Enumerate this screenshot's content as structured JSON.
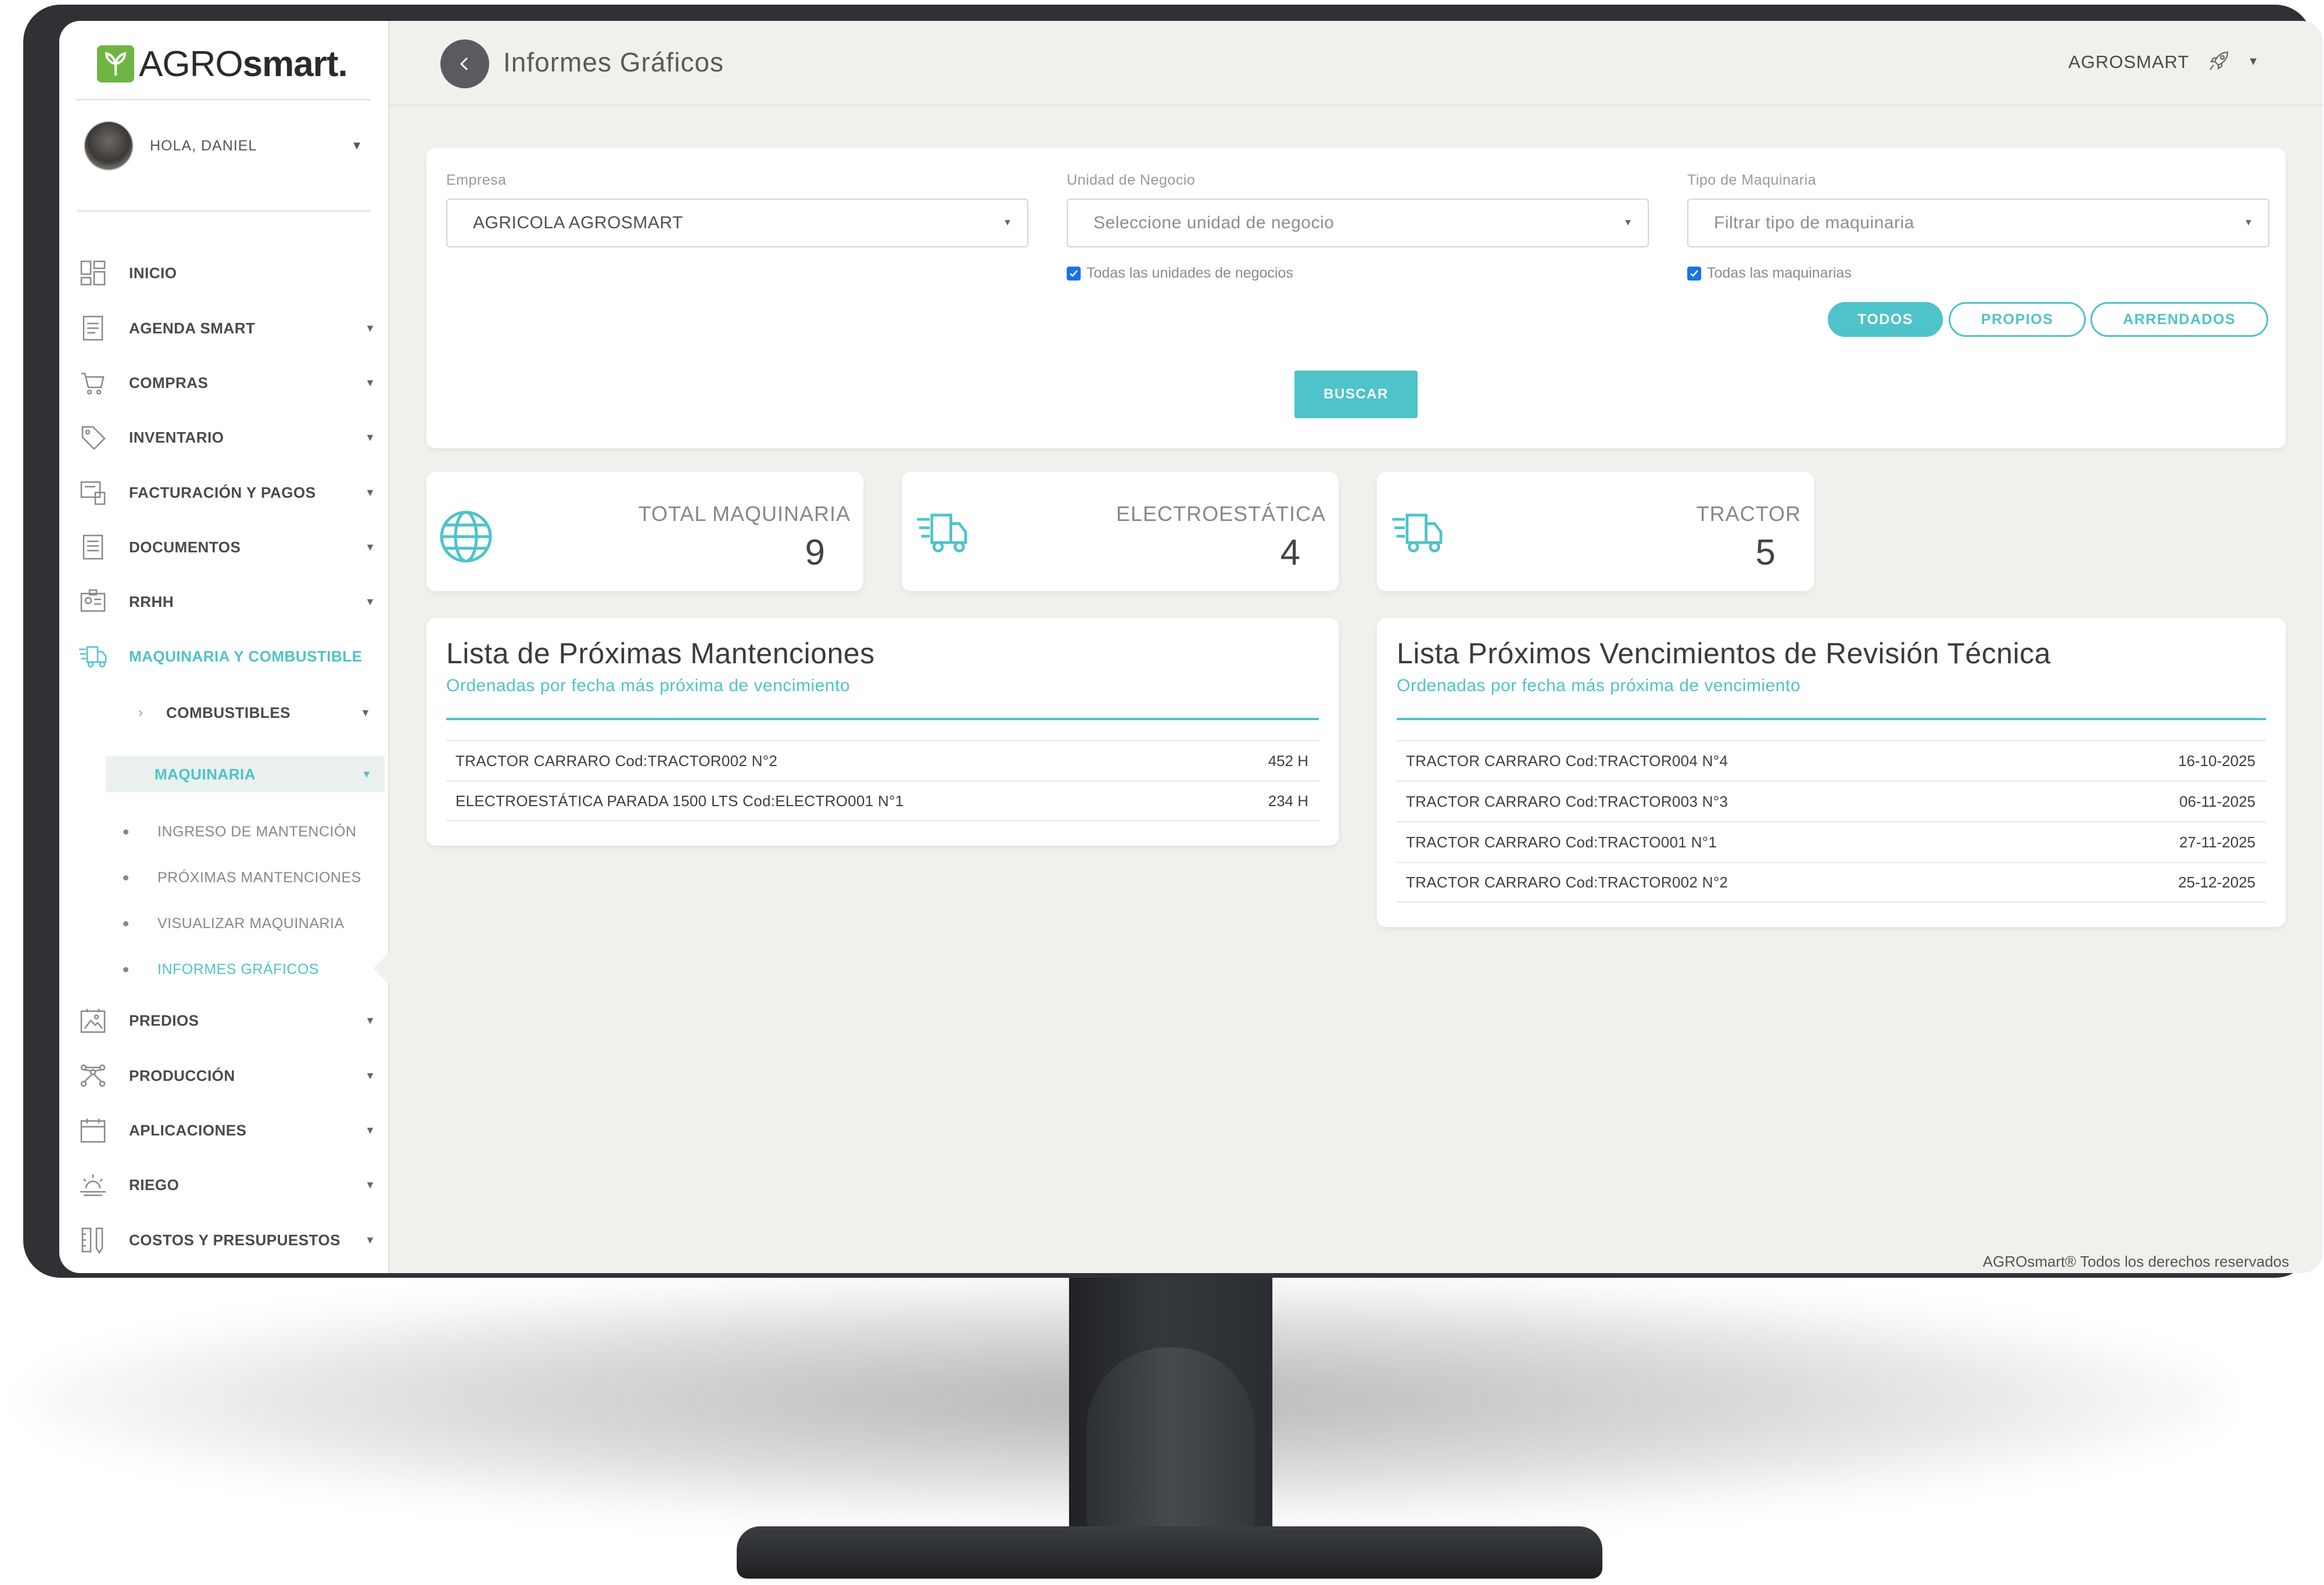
{
  "app": {
    "logo_prefix": "AGRO",
    "logo_suffix": "smart."
  },
  "user": {
    "greeting": "HOLA, DANIEL"
  },
  "sidebar": {
    "items": [
      {
        "label": "INICIO",
        "icon": "dashboard-icon"
      },
      {
        "label": "AGENDA SMART",
        "icon": "agenda-icon"
      },
      {
        "label": "COMPRAS",
        "icon": "cart-icon"
      },
      {
        "label": "INVENTARIO",
        "icon": "tag-icon"
      },
      {
        "label": "FACTURACIÓN Y PAGOS",
        "icon": "billing-icon"
      },
      {
        "label": "DOCUMENTOS",
        "icon": "document-icon"
      },
      {
        "label": "RRHH",
        "icon": "id-card-icon"
      },
      {
        "label": "MAQUINARIA Y COMBUSTIBLE",
        "icon": "truck-icon"
      }
    ],
    "sub": {
      "combustibles": "COMBUSTIBLES",
      "maquinaria": "MAQUINARIA"
    },
    "subsub": [
      "INGRESO DE MANTENCIÓN",
      "PRÓXIMAS MANTENCIONES",
      "VISUALIZAR MAQUINARIA",
      "INFORMES GRÁFICOS"
    ],
    "items_after": [
      {
        "label": "PREDIOS",
        "icon": "map-icon"
      },
      {
        "label": "PRODUCCIÓN",
        "icon": "production-icon"
      },
      {
        "label": "APLICACIONES",
        "icon": "calendar-icon"
      },
      {
        "label": "RIEGO",
        "icon": "sun-icon"
      },
      {
        "label": "COSTOS Y PRESUPUESTOS",
        "icon": "ruler-icon"
      }
    ]
  },
  "header": {
    "title": "Informes Gráficos",
    "org": "AGROSMART"
  },
  "filters": {
    "empresa_label": "Empresa",
    "empresa_value": "AGRICOLA AGROSMART",
    "unidad_label": "Unidad de Negocio",
    "unidad_placeholder": "Seleccione unidad de negocio",
    "unidad_check": "Todas las unidades de negocios",
    "tipo_label": "Tipo de Maquinaria",
    "tipo_placeholder": "Filtrar tipo de maquinaria",
    "tipo_check": "Todas las maquinarias",
    "pills": [
      "TODOS",
      "PROPIOS",
      "ARRENDADOS"
    ],
    "search": "BUSCAR"
  },
  "stats": [
    {
      "label": "TOTAL MAQUINARIA",
      "value": "9",
      "icon": "globe-icon"
    },
    {
      "label": "ELECTROESTÁTICA",
      "value": "4",
      "icon": "truck-icon"
    },
    {
      "label": "TRACTOR",
      "value": "5",
      "icon": "truck-icon"
    }
  ],
  "mantenciones": {
    "title": "Lista de Próximas Mantenciones",
    "subtitle": "Ordenadas por fecha más próxima de vencimiento",
    "rows": [
      {
        "name": "TRACTOR CARRARO Cod:TRACTOR002 N°2",
        "value": "452 H"
      },
      {
        "name": "ELECTROESTÁTICA PARADA 1500 LTS Cod:ELECTRO001 N°1",
        "value": "234 H"
      }
    ]
  },
  "revision": {
    "title": "Lista Próximos Vencimientos de Revisión Técnica",
    "subtitle": "Ordenadas por fecha más próxima de vencimiento",
    "rows": [
      {
        "name": "TRACTOR CARRARO Cod:TRACTOR004 N°4",
        "value": "16-10-2025"
      },
      {
        "name": "TRACTOR CARRARO Cod:TRACTOR003 N°3",
        "value": "06-11-2025"
      },
      {
        "name": "TRACTOR CARRARO Cod:TRACTO001 N°1",
        "value": "27-11-2025"
      },
      {
        "name": "TRACTOR CARRARO Cod:TRACTOR002 N°2",
        "value": "25-12-2025"
      }
    ]
  },
  "footer": "AGROsmart® Todos los derechos reservados",
  "colors": {
    "accent": "#4ec3c9",
    "logo_green": "#6fb544",
    "bezel": "#2f3135"
  }
}
